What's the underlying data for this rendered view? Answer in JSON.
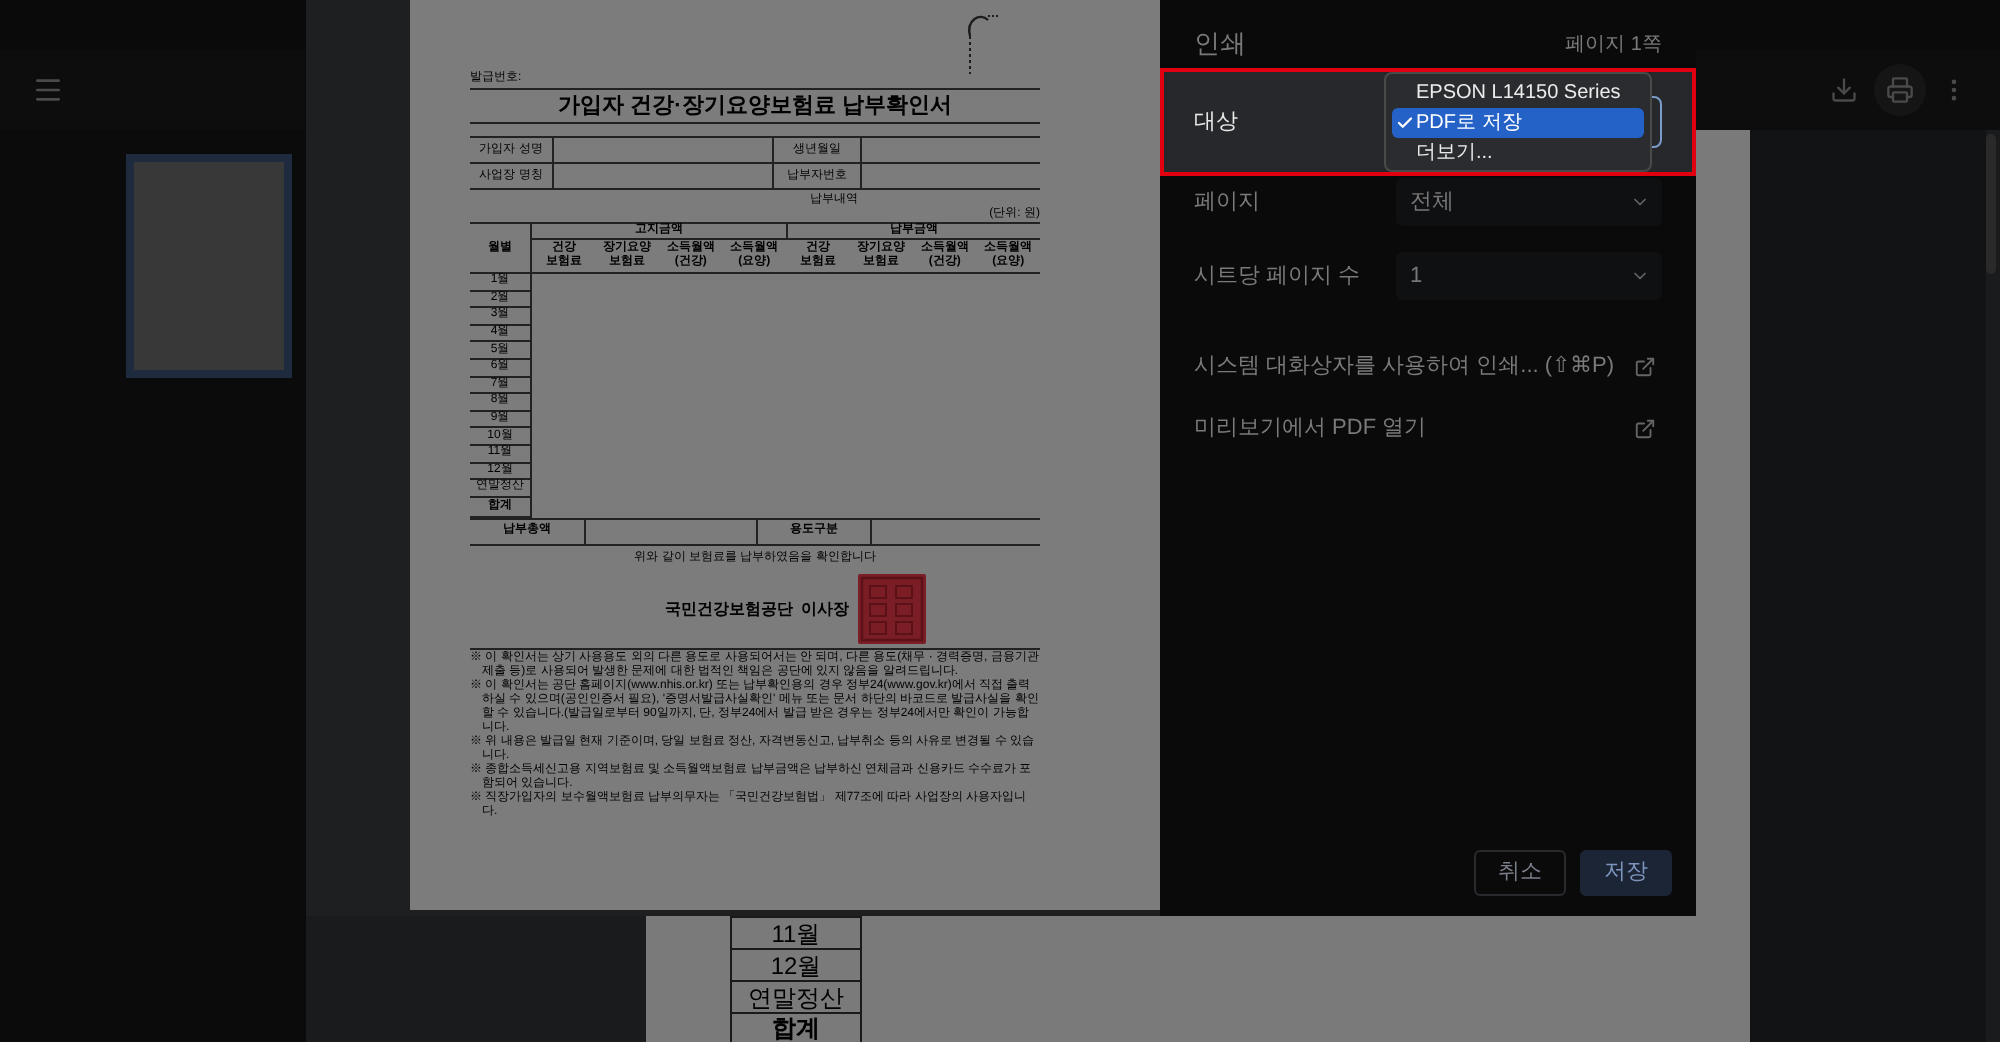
{
  "viewer": {
    "thumbnail": {
      "selected": true
    },
    "page_rows": [
      {
        "label": "11월",
        "kind": "month"
      },
      {
        "label": "12월",
        "kind": "month"
      },
      {
        "label": "연말정산",
        "kind": "month"
      },
      {
        "label": "합계",
        "kind": "total"
      }
    ]
  },
  "document": {
    "issue_no": "발급번호:",
    "title": "가입자 건강·장기요양보험료 납부확인서",
    "info_rows": [
      [
        "가입자 성명",
        "생년월일"
      ],
      [
        "사업장 명칭",
        "납부자번호"
      ]
    ],
    "section_title": "납부내역",
    "unit": "(단위: 원)",
    "month_header": "월별",
    "group_headers": [
      "고지금액",
      "납부금액"
    ],
    "column_headers": [
      "건강 보험료",
      "장기요양 보험료",
      "소득월액 (건강)",
      "소득월액 (요양)",
      "건강 보험료",
      "장기요양 보험료",
      "소득월액 (건강)",
      "소득월액 (요양)"
    ],
    "rows": [
      {
        "label": "1월",
        "kind": "month"
      },
      {
        "label": "2월",
        "kind": "month"
      },
      {
        "label": "3월",
        "kind": "month"
      },
      {
        "label": "4월",
        "kind": "month"
      },
      {
        "label": "5월",
        "kind": "month"
      },
      {
        "label": "6월",
        "kind": "month"
      },
      {
        "label": "7월",
        "kind": "month"
      },
      {
        "label": "8월",
        "kind": "month"
      },
      {
        "label": "9월",
        "kind": "month"
      },
      {
        "label": "10월",
        "kind": "month"
      },
      {
        "label": "11월",
        "kind": "month"
      },
      {
        "label": "12월",
        "kind": "month"
      },
      {
        "label": "연말정산",
        "kind": "month"
      },
      {
        "label": "합계",
        "kind": "total"
      }
    ],
    "footer_labels": [
      "납부총액",
      "용도구분"
    ],
    "confirmation": "위와 같이 보험료를 납부하였음을 확인합니다",
    "issuer": "국민건강보험공단  이사장",
    "notes": [
      "※ 이 확인서는 상기 사용용도 외의 다른 용도로 사용되어서는 안 되며, 다른 용도(채무 · 경력증명, 금융기관 제출 등)로 사용되어 발생한 문제에 대한 법적인 책임은 공단에 있지 않음을 알려드립니다.",
      "※ 이 확인서는 공단 홈페이지(www.nhis.or.kr) 또는 납부확인용의 경우 정부24(www.gov.kr)에서 직접 출력하실 수 있으며(공인인증서 필요), '증명서발급사실확인' 메뉴 또는 문서 하단의 바코드로 발급사실을 확인할 수 있습니다.(발급일로부터 90일까지, 단, 정부24에서 발급 받은 경우는 정부24에서만 확인이 가능합니다.",
      "※ 위 내용은 발급일 현재 기준이며, 당일 보험료 정산, 자격변동신고, 납부취소 등의 사유로 변경될 수 있습니다.",
      "※ 종합소득세신고용 지역보험료 및 소득월액보험료 납부금액은 납부하신 연체금과 신용카드 수수료가 포함되어 있습니다.",
      "※ 직장가입자의 보수월액보험료 납부의무자는 「국민건강보험법」 제77조에 따라 사업장의 사용자입니다."
    ]
  },
  "print_dialog": {
    "title": "인쇄",
    "page_count": "페이지 1쪽",
    "destination": {
      "label": "대상",
      "expanded": true,
      "options": [
        {
          "label": "EPSON L14150 Series",
          "selected": false
        },
        {
          "label": "PDF로 저장",
          "selected": true
        },
        {
          "label": "더보기...",
          "selected": false
        }
      ]
    },
    "settings": [
      {
        "label": "페이지",
        "value": "전체"
      },
      {
        "label": "시트당 페이지 수",
        "value": "1"
      }
    ],
    "links": [
      {
        "label": "시스템 대화상자를 사용하여 인쇄... (⇧⌘P)"
      },
      {
        "label": "미리보기에서 PDF 열기"
      }
    ],
    "buttons": [
      {
        "label": "취소",
        "kind": "secondary"
      },
      {
        "label": "저장",
        "kind": "primary"
      }
    ]
  }
}
